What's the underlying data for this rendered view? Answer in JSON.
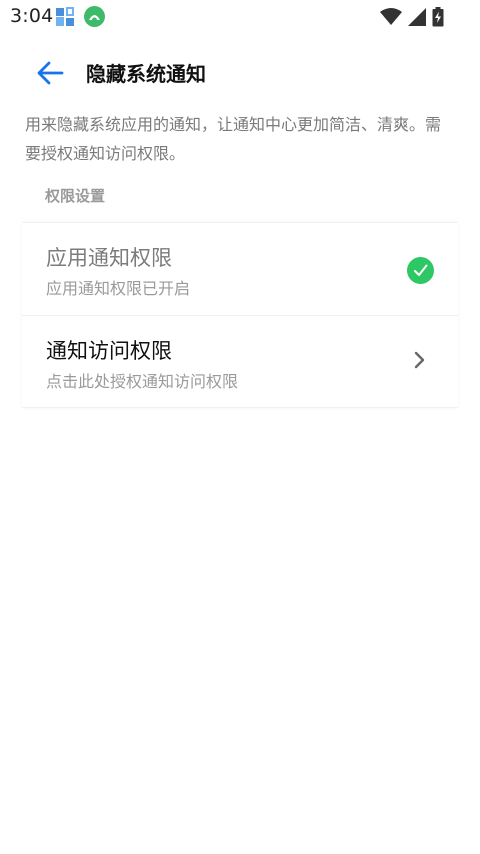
{
  "status_bar": {
    "time": "3:04",
    "icons": [
      "app-grid-icon",
      "green-app-icon",
      "wifi-icon",
      "signal-icon",
      "battery-charging-icon"
    ]
  },
  "header": {
    "title": "隐藏系统通知",
    "back_icon": "arrow-left-icon"
  },
  "description": "用来隐藏系统应用的通知，让通知中心更加简洁、清爽。需要授权通知访问权限。",
  "section": {
    "header": "权限设置",
    "items": [
      {
        "title": "应用通知权限",
        "subtitle": "应用通知权限已开启",
        "trailing_icon": "check-circle-icon"
      },
      {
        "title": "通知访问权限",
        "subtitle": "点击此处授权通知访问权限",
        "trailing_icon": "chevron-right-icon"
      }
    ]
  },
  "colors": {
    "accent": "#1a73e8",
    "success": "#2ec765",
    "title_text": "#111111",
    "secondary_text": "#9a9a9a"
  }
}
